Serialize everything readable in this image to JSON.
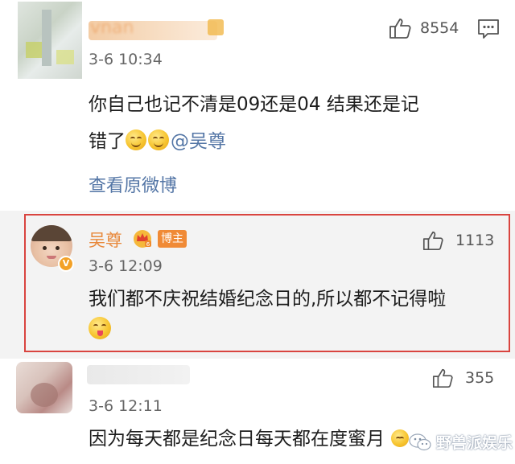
{
  "comment1": {
    "name_blurred": "vnan",
    "likes": "8554",
    "time": "3-6 10:34",
    "text_line1": "你自己也记不清是09还是04 结果还是记",
    "text_line2": "错了",
    "mention": "@吴尊",
    "view_original": "查看原微博"
  },
  "comment2": {
    "name": "吴尊",
    "badge": "博主",
    "likes": "1113",
    "time": "3-6 12:09",
    "text": "我们都不庆祝结婚纪念日的,所以都不记得啦"
  },
  "comment3": {
    "likes": "355",
    "time": "3-6 12:11",
    "text": "因为每天都是纪念日每天都在度蜜月"
  },
  "watermark": "野兽派娱乐",
  "colors": {
    "highlight_border": "#d9443f",
    "name_orange": "#e8883a",
    "link_blue": "#5476a6",
    "shaded_bg": "#f3f3f3"
  },
  "icons": [
    "thumbs-up-icon",
    "comment-icon",
    "crown-icon",
    "verified-v-icon",
    "grin-emoji",
    "wink-tongue-emoji",
    "wechat-icon"
  ]
}
